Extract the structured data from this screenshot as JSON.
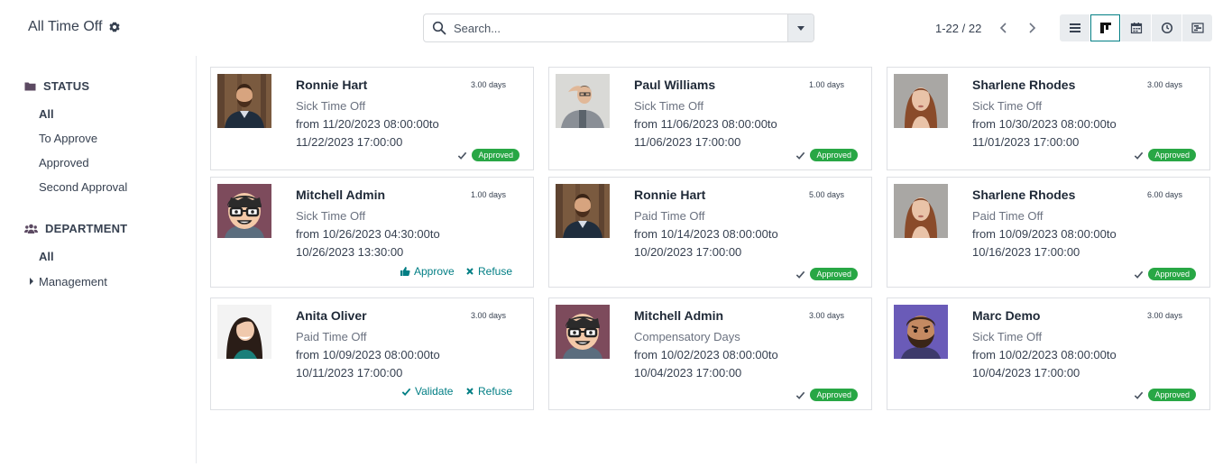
{
  "header": {
    "title": "All Time Off",
    "search_placeholder": "Search...",
    "pager": "1-22 / 22"
  },
  "views": [
    "list-icon",
    "kanban-icon",
    "calendar-icon",
    "activity-icon",
    "gantt-icon"
  ],
  "sidebar": {
    "status_heading": "STATUS",
    "status_items": [
      "All",
      "To Approve",
      "Approved",
      "Second Approval"
    ],
    "department_heading": "DEPARTMENT",
    "department_items": [
      "All",
      "Management"
    ]
  },
  "colors": {
    "accent": "#017e84",
    "approved": "#28a745"
  },
  "cards": [
    {
      "name": "Ronnie Hart",
      "days": "3.00 days",
      "type": "Sick Time Off",
      "from": "from 11/20/2023 08:00:00to",
      "to": "11/22/2023 17:00:00",
      "status": "Approved",
      "avatar": "photo-man-beard"
    },
    {
      "name": "Paul Williams",
      "days": "1.00 days",
      "type": "Sick Time Off",
      "from": "from 11/06/2023 08:00:00to",
      "to": "11/06/2023 17:00:00",
      "status": "Approved",
      "avatar": "photo-man-glasses"
    },
    {
      "name": "Sharlene Rhodes",
      "days": "3.00 days",
      "type": "Sick Time Off",
      "from": "from 10/30/2023 08:00:00to",
      "to": "11/01/2023 17:00:00",
      "status": "Approved",
      "avatar": "photo-woman-red-hair"
    },
    {
      "name": "Mitchell Admin",
      "days": "1.00 days",
      "type": "Sick Time Off",
      "from": "from 10/26/2023 04:30:00to",
      "to": "10/26/2023 13:30:00",
      "actions": [
        "Approve",
        "Refuse"
      ],
      "avatar": "cartoon-admin"
    },
    {
      "name": "Ronnie Hart",
      "days": "5.00 days",
      "type": "Paid Time Off",
      "from": "from 10/14/2023 08:00:00to",
      "to": "10/20/2023 17:00:00",
      "status": "Approved",
      "avatar": "photo-man-beard"
    },
    {
      "name": "Sharlene Rhodes",
      "days": "6.00 days",
      "type": "Paid Time Off",
      "from": "from 10/09/2023 08:00:00to",
      "to": "10/16/2023 17:00:00",
      "status": "Approved",
      "avatar": "photo-woman-red-hair"
    },
    {
      "name": "Anita Oliver",
      "days": "3.00 days",
      "type": "Paid Time Off",
      "from": "from 10/09/2023 08:00:00to",
      "to": "10/11/2023 17:00:00",
      "actions": [
        "Validate",
        "Refuse"
      ],
      "avatar": "photo-woman-dark-hair"
    },
    {
      "name": "Mitchell Admin",
      "days": "3.00 days",
      "type": "Compensatory Days",
      "from": "from 10/02/2023 08:00:00to",
      "to": "10/04/2023 17:00:00",
      "status": "Approved",
      "avatar": "cartoon-admin"
    },
    {
      "name": "Marc Demo",
      "days": "3.00 days",
      "type": "Sick Time Off",
      "from": "from 10/02/2023 08:00:00to",
      "to": "10/04/2023 17:00:00",
      "status": "Approved",
      "avatar": "cartoon-marc"
    }
  ]
}
